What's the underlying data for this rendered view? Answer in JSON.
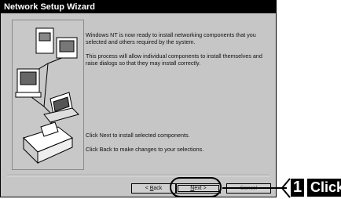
{
  "window": {
    "title": "Network Setup Wizard"
  },
  "content": {
    "paragraph1": "Windows NT is now ready to install networking components that you selected and others required by the system.",
    "paragraph2": "This process will allow individual components to install themselves and raise dialogs so that they may install correctly.",
    "paragraph3": "Click Next to install selected components.",
    "paragraph4": "Click Back to make changes to your selections."
  },
  "buttons": {
    "back_prefix": "< ",
    "back_accel": "B",
    "back_rest": "ack",
    "next_accel": "N",
    "next_rest": "ext >",
    "cancel": "Cancel"
  },
  "annotation": {
    "step_number": "1",
    "action": "Click"
  }
}
